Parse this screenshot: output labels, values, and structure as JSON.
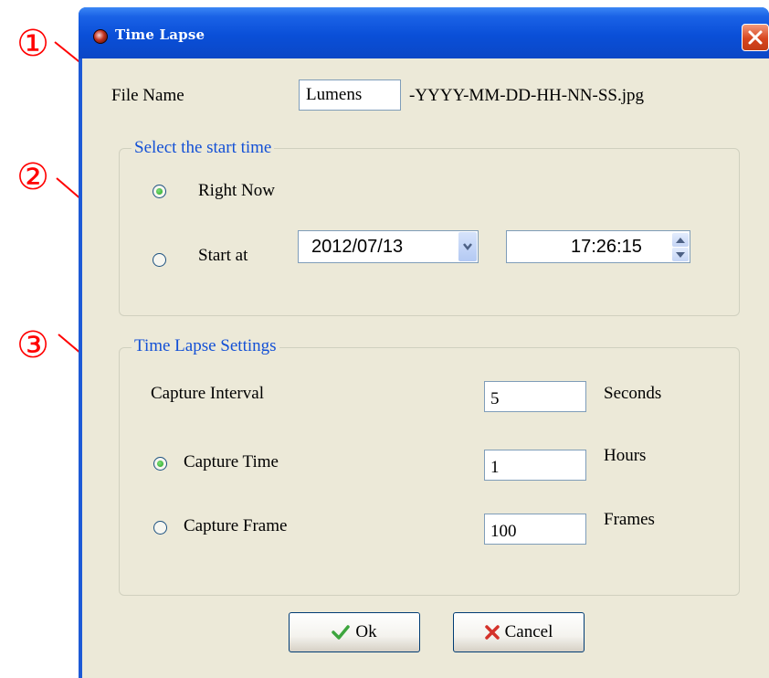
{
  "window": {
    "title": "Time Lapse",
    "icon": "camera-icon",
    "close_icon": "close-icon"
  },
  "file_name": {
    "label": "File Name",
    "value": "Lumens",
    "suffix": "-YYYY-MM-DD-HH-NN-SS.jpg"
  },
  "start_time": {
    "legend": "Select the start time",
    "right_now_label": "Right Now",
    "start_at_label": "Start at",
    "selected": "right_now",
    "date_value": "2012/07/13",
    "time_value": "17:26:15"
  },
  "settings": {
    "legend": "Time Lapse Settings",
    "interval_label": "Capture Interval",
    "interval_value": "5",
    "interval_unit": "Seconds",
    "time_label": "Capture Time",
    "time_value": "1",
    "time_unit": "Hours",
    "frame_label": "Capture Frame",
    "frame_value": "100",
    "frame_unit": "Frames",
    "selected": "capture_time"
  },
  "buttons": {
    "ok_label": "Ok",
    "cancel_label": "Cancel"
  },
  "annotations": {
    "marker1": "①",
    "marker2": "②",
    "marker3": "③",
    "color": "#ff0000"
  },
  "colors": {
    "titlebar": "#0a4fd8",
    "client_bg": "#ece9d8",
    "group_legend": "#1350d6",
    "close_button": "#d7451f"
  }
}
